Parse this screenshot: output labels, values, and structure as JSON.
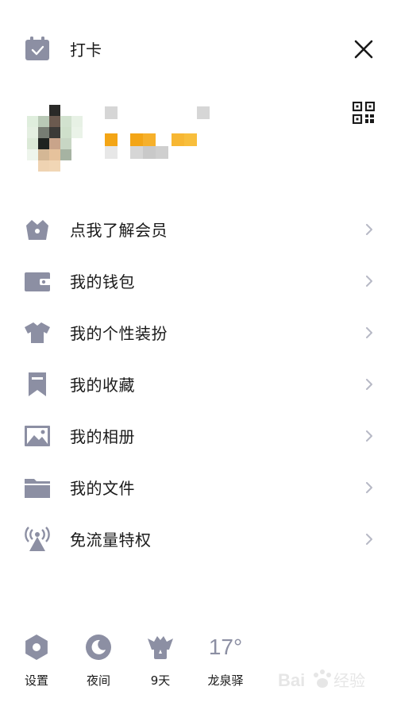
{
  "colors": {
    "icon": "#8c8fa3",
    "chevron": "#b7b9c6",
    "text": "#1a1a1a",
    "accent_orange": "#f3a516"
  },
  "header": {
    "checkin_label": "打卡",
    "checkin_icon": "calendar-check-icon",
    "close_icon": "close-icon"
  },
  "profile": {
    "qr_icon": "qr-code-icon"
  },
  "menu": {
    "items": [
      {
        "label": "点我了解会员",
        "icon": "vip-crown-icon"
      },
      {
        "label": "我的钱包",
        "icon": "wallet-icon"
      },
      {
        "label": "我的个性装扮",
        "icon": "tshirt-icon"
      },
      {
        "label": "我的收藏",
        "icon": "bookmark-icon"
      },
      {
        "label": "我的相册",
        "icon": "photo-album-icon"
      },
      {
        "label": "我的文件",
        "icon": "folder-icon"
      },
      {
        "label": "免流量特权",
        "icon": "signal-tower-icon"
      }
    ]
  },
  "footer": {
    "settings_label": "设置",
    "night_label": "夜间",
    "days_label": "9天",
    "temperature": "17°",
    "location": "龙泉驿"
  },
  "watermark": {
    "text": "Bai 经验"
  }
}
